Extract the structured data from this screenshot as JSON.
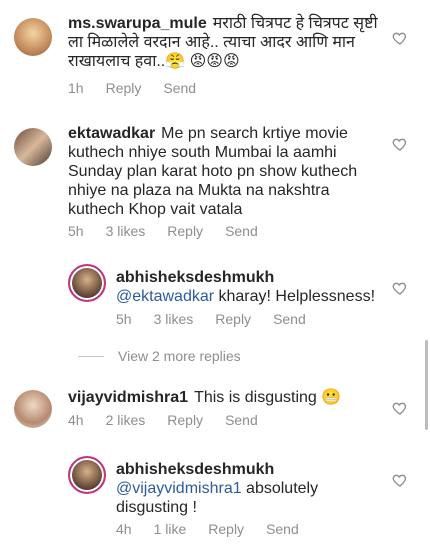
{
  "comments": [
    {
      "username": "ms.swarupa_mule",
      "text": "मराठी चित्रपट हे चित्रपट सृष्टी ला मिळालेले वरदान आहे.. त्याचा आदर आणि मान राखायलाच हवा..😤 😡😡😡",
      "time": "1h",
      "reply": "Reply",
      "send": "Send"
    },
    {
      "username": "ektawadkar",
      "text": "Me pn search krtiye movie kuthech nhiye south Mumbai la aamhi Sunday plan karat hoto pn show kuthech nhiye na plaza na Mukta na nakshtra kuthech Khop vait vatala",
      "time": "5h",
      "likes": "3 likes",
      "reply": "Reply",
      "send": "Send"
    },
    {
      "username": "abhisheksdeshmukh",
      "mention": "@ektawadkar",
      "text": " kharay! Helplessness!",
      "time": "5h",
      "likes": "3 likes",
      "reply": "Reply",
      "send": "Send"
    },
    {
      "username": "vijayvidmishra1",
      "text": "This is disgusting 😬",
      "time": "4h",
      "likes": "2 likes",
      "reply": "Reply",
      "send": "Send"
    },
    {
      "username": "abhisheksdeshmukh",
      "mention": "@vijayvidmishra1",
      "text": " absolutely disgusting !",
      "time": "4h",
      "likes": "1 like",
      "reply": "Reply",
      "send": "Send"
    }
  ],
  "view_more": "View 2 more replies",
  "colors": {
    "mention": "#2c5c9c",
    "meta": "#8e8e8e",
    "ring": "#c13584"
  }
}
